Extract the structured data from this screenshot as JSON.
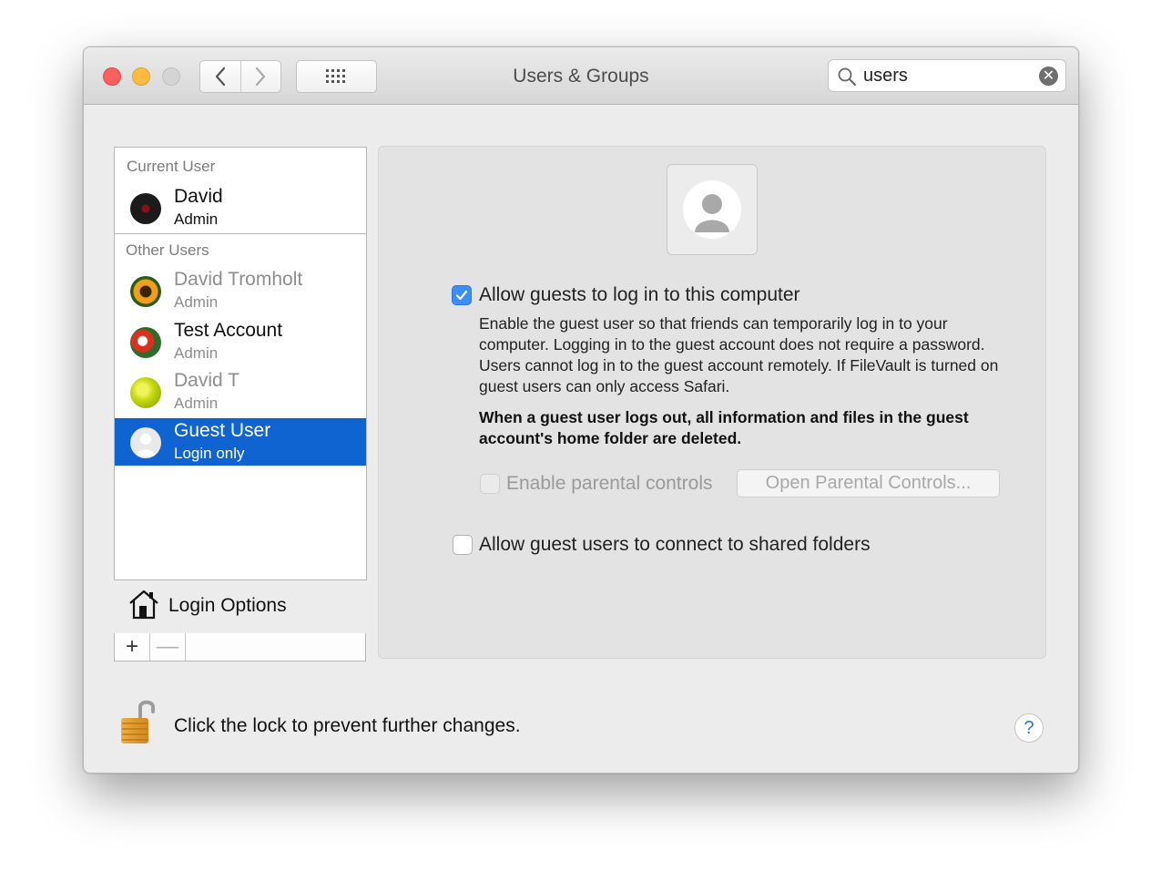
{
  "window": {
    "title": "Users & Groups"
  },
  "toolbar": {
    "back_icon": "chevron-left-icon",
    "forward_icon": "chevron-right-icon",
    "show_all_icon": "grid-icon"
  },
  "search": {
    "value": "users",
    "icon": "search-icon",
    "clear_icon": "clear-icon"
  },
  "sidebar": {
    "current_user_header": "Current User",
    "current_user": {
      "name": "David",
      "role": "Admin"
    },
    "other_users_header": "Other Users",
    "other_users": [
      {
        "name": "David Tromholt",
        "role": "Admin"
      },
      {
        "name": "Test Account",
        "role": "Admin"
      },
      {
        "name": "David T",
        "role": "Admin"
      },
      {
        "name": "Guest User",
        "role": "Login only"
      }
    ],
    "login_options": "Login Options",
    "add_label": "+",
    "remove_label": "—"
  },
  "panel": {
    "allow_guests_label": "Allow guests to log in to this computer",
    "allow_guests_checked": true,
    "description": "Enable the guest user so that friends can temporarily log in to your computer. Logging in to the guest account does not require a password. Users cannot log in to the guest account remotely. If FileVault is turned on guest users can only access Safari.",
    "warning": "When a guest user logs out, all information and files in the guest account's home folder are deleted.",
    "parental_controls_label": "Enable parental controls",
    "parental_controls_checked": false,
    "open_parental_button": "Open Parental Controls...",
    "shared_folders_label": "Allow guest users to connect to shared folders",
    "shared_folders_checked": false
  },
  "footer": {
    "lock_text": "Click the lock to prevent further changes.",
    "help_label": "?"
  },
  "colors": {
    "selection": "#0f64d2",
    "checkbox_accent": "#3b8ef5"
  }
}
